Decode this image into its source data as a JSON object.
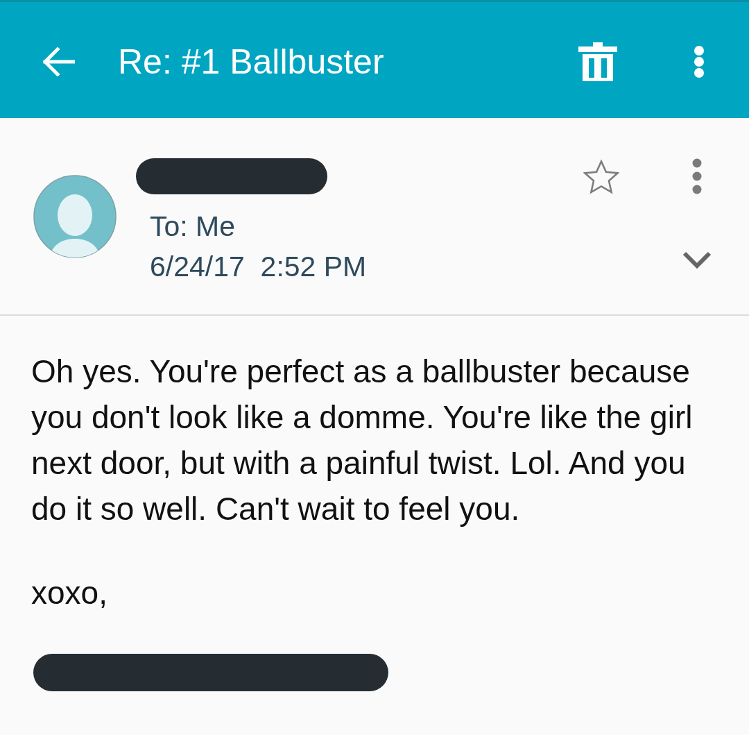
{
  "toolbar": {
    "title": "Re: #1 Ballbuster"
  },
  "header": {
    "sender_redacted": true,
    "to": "To: Me",
    "date": "6/24/17  2:52 PM",
    "starred": false,
    "expanded": false
  },
  "body": {
    "paragraphs": [
      "Oh yes. You're perfect as a ballbuster because you don't look like a domme. You're like the girl next door, but with a painful twist. Lol. And you do it so well. Can't wait to feel you.",
      "xoxo,"
    ],
    "signature_redacted": true
  }
}
